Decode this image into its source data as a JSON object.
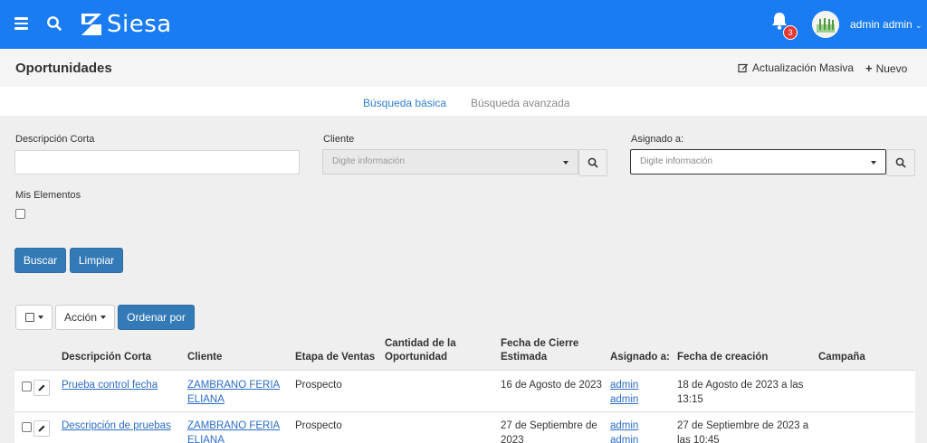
{
  "topbar": {
    "brand": "Siesa",
    "notifications_count": "3",
    "user_name": "admin admin",
    "colors": {
      "primary": "#1a7cf2",
      "badge": "#e53935"
    }
  },
  "header": {
    "title": "Oportunidades",
    "bulk_update_label": "Actualización Masiva",
    "new_label": "Nuevo"
  },
  "tabs": {
    "basic": "Búsqueda básica",
    "advanced": "Búsqueda avanzada"
  },
  "filters": {
    "short_description_label": "Descripción Corta",
    "short_description_value": "",
    "client_label": "Cliente",
    "client_placeholder": "Digite información",
    "assigned_label": "Asignado a:",
    "assigned_placeholder": "Digite información",
    "my_items_label": "Mis Elementos"
  },
  "buttons": {
    "search": "Buscar",
    "clear": "Limpiar",
    "action": "Acción",
    "order_by": "Ordenar por"
  },
  "table": {
    "columns": {
      "short_description": "Descripción Corta",
      "client": "Cliente",
      "sales_stage": "Etapa de Ventas",
      "amount_line1": "Cantidad de la",
      "amount_line2": "Oportunidad",
      "close_date_line1": "Fecha de Cierre",
      "close_date_line2": "Estimada",
      "assigned": "Asignado a:",
      "created": "Fecha de creación",
      "campaign": "Campaña"
    },
    "rows": [
      {
        "description": "Prueba control fecha",
        "client_line1": "ZAMBRANO FERIA",
        "client_line2": "ELIANA",
        "stage": "Prospecto",
        "amount": "",
        "close_line1": "16 de Agosto de 2023",
        "close_line2": "",
        "assigned_line1": "admin",
        "assigned_line2": "admin",
        "created_line1": "18 de Agosto de 2023 a las",
        "created_line2": "13:15",
        "campaign": ""
      },
      {
        "description": "Descripción de pruebas",
        "client_line1": "ZAMBRANO FERIA",
        "client_line2": "ELIANA",
        "stage": "Prospecto",
        "amount": "",
        "close_line1": "27 de Septiembre de",
        "close_line2": "2023",
        "assigned_line1": "admin",
        "assigned_line2": "admin",
        "created_line1": "27 de Septiembre de 2023 a",
        "created_line2": "las 10:45",
        "campaign": ""
      }
    ]
  }
}
